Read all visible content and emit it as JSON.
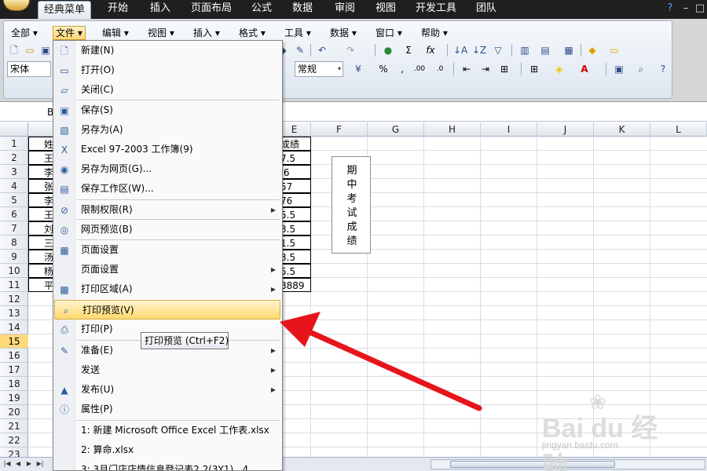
{
  "ribbon_tabs": [
    "经典菜单",
    "开始",
    "插入",
    "页面布局",
    "公式",
    "数据",
    "审阅",
    "视图",
    "开发工具",
    "团队"
  ],
  "classic_menus": [
    "全部",
    "文件",
    "编辑",
    "视图",
    "插入",
    "格式",
    "工具",
    "数据",
    "窗口",
    "帮助"
  ],
  "font_name": "宋体",
  "number_format": "常规",
  "name_box": "B",
  "column_headers": [
    "E",
    "F",
    "G",
    "H",
    "I",
    "J",
    "K",
    "L"
  ],
  "row_headers": [
    "1",
    "2",
    "3",
    "4",
    "5",
    "6",
    "7",
    "8",
    "9",
    "10",
    "11",
    "12",
    "13",
    "14",
    "15",
    "16",
    "17",
    "18",
    "19",
    "20",
    "21",
    "22",
    "23"
  ],
  "selected_row": "15",
  "visible_cells": {
    "names_partial": [
      "姓",
      "王",
      "李",
      "张",
      "李",
      "王",
      "刘",
      "三",
      "汤",
      "杨",
      "平"
    ],
    "scores_partial": [
      "成绩",
      "7.5",
      ".6",
      "57",
      "76",
      "5.5",
      "3.5",
      "1.5",
      "3.5",
      "5.5",
      "8889"
    ]
  },
  "textbox_text": [
    "期",
    "中",
    "考",
    "试",
    "成",
    "绩"
  ],
  "file_menu": [
    {
      "icon": "new-document-icon",
      "label": "新建(N)"
    },
    {
      "icon": "open-folder-icon",
      "label": "打开(O)"
    },
    {
      "icon": "close-file-icon",
      "label": "关闭(C)"
    },
    {
      "icon": "save-icon",
      "label": "保存(S)"
    },
    {
      "icon": "save-as-icon",
      "label": "另存为(A)"
    },
    {
      "icon": "excel-icon",
      "label": "Excel 97-2003 工作簿(9)"
    },
    {
      "icon": "web-save-icon",
      "label": "另存为网页(G)..."
    },
    {
      "icon": "workspace-icon",
      "label": "保存工作区(W)..."
    },
    {
      "icon": "permission-icon",
      "label": "限制权限(R)"
    },
    {
      "icon": "web-preview-icon",
      "label": "网页预览(B)"
    },
    {
      "icon": "page-setup-icon",
      "label": "页面设置"
    },
    {
      "icon": "",
      "label": "页面设置"
    },
    {
      "icon": "print-area-icon",
      "label": "打印区域(A)"
    },
    {
      "icon": "print-preview-icon",
      "label": "打印预览(V)"
    },
    {
      "icon": "printer-icon",
      "label": "打印(P)"
    },
    {
      "icon": "prepare-icon",
      "label": "准备(E)"
    },
    {
      "icon": "",
      "label": "发送"
    },
    {
      "icon": "publish-icon",
      "label": "发布(U)"
    },
    {
      "icon": "properties-icon",
      "label": "属性(P)"
    },
    {
      "icon": "",
      "label": "1: 新建 Microsoft Office Excel 工作表.xlsx"
    },
    {
      "icon": "",
      "label": "2: 算命.xlsx"
    },
    {
      "icon": "",
      "label": "3: 3月门店店情信息登记表2.2(3Y1)...4"
    }
  ],
  "tooltip": "打印预览 (Ctrl+F2)",
  "watermark": {
    "brand": "Bai du 经验",
    "url": "jingyan.baidu.com"
  },
  "colors": {
    "highlight": "#ffd96f",
    "arrow": "#e8141b",
    "selected_row": "#ffd87a"
  }
}
